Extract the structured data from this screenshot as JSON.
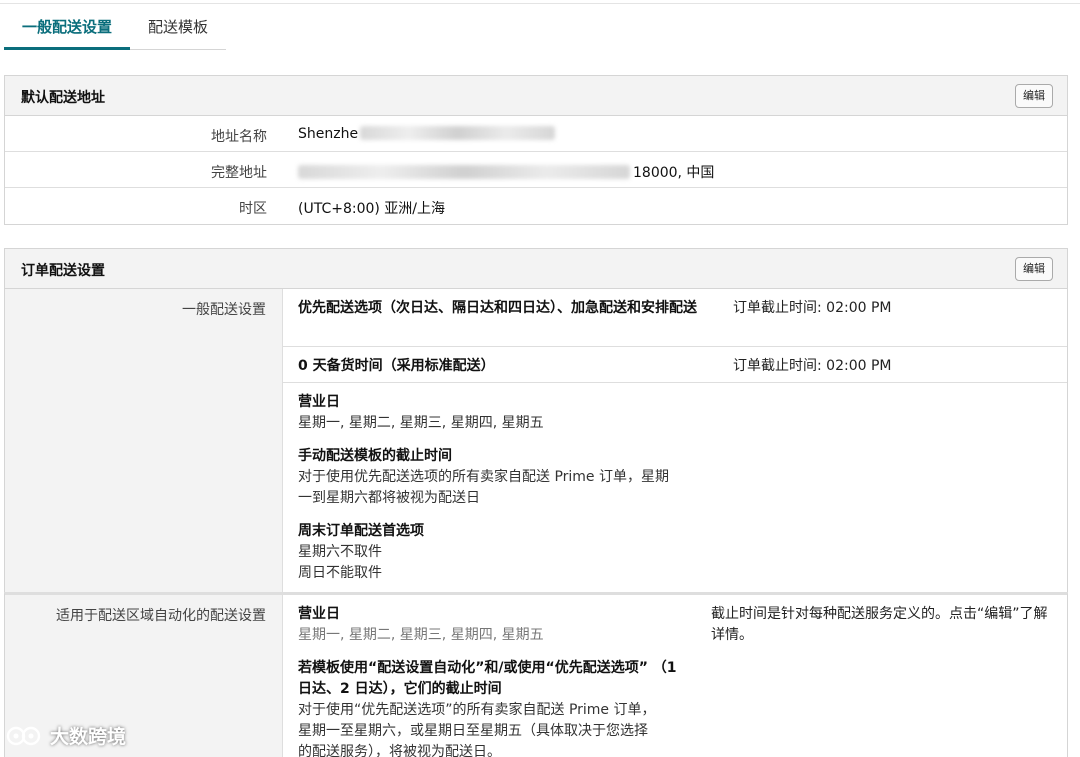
{
  "tabs": [
    {
      "label": "一般配送设置",
      "active": true
    },
    {
      "label": "配送模板",
      "active": false
    }
  ],
  "default_address": {
    "title": "默认配送地址",
    "edit_label": "编辑",
    "rows": [
      {
        "label": "地址名称",
        "value": "Shenzhe"
      },
      {
        "label": "完整地址",
        "value": "18000, 中国"
      },
      {
        "label": "时区",
        "value": "(UTC+8:00) 亚洲/上海"
      }
    ]
  },
  "order_settings": {
    "title": "订单配送设置",
    "edit_label": "编辑",
    "general_label": "一般配送设置",
    "general_rows": [
      {
        "main": "优先配送选项（次日达、隔日达和四日达）、加急配送和安排配送",
        "side": "订单截止时间: 02:00 PM"
      },
      {
        "main": "0 天备货时间（采用标准配送）",
        "side": "订单截止时间: 02:00 PM"
      }
    ],
    "details": [
      {
        "heading": "营业日",
        "lines": [
          "星期一, 星期二, 星期三, 星期四, 星期五"
        ]
      },
      {
        "heading": "手动配送模板的截止时间",
        "lines": [
          "对于使用优先配送选项的所有卖家自配送 Prime 订单，星期",
          "一到星期六都将被视为配送日"
        ]
      },
      {
        "heading": "周末订单配送首选项",
        "lines": [
          "星期六不取件",
          "周日不能取件"
        ]
      }
    ],
    "auto_label": "适用于配送区域自动化的配送设置",
    "auto_main": [
      {
        "heading": "营业日",
        "lines": [
          "星期一, 星期二, 星期三, 星期四, 星期五"
        ],
        "light": true
      },
      {
        "heading": "若模板使用“配送设置自动化”和/或使用“优先配送选项” （1 日达、2 日达），它们的截止时间",
        "lines": [
          "对于使用“优先配送选项”的所有卖家自配送 Prime 订单，",
          "星期一至星期六，或星期日至星期五（具体取决于您选择",
          "的配送服务），将被视为配送日。"
        ],
        "light": false
      }
    ],
    "auto_side": "截止时间是针对每种配送服务定义的。点击“编辑”了解详情。"
  },
  "watermark": {
    "text": "大数跨境"
  }
}
